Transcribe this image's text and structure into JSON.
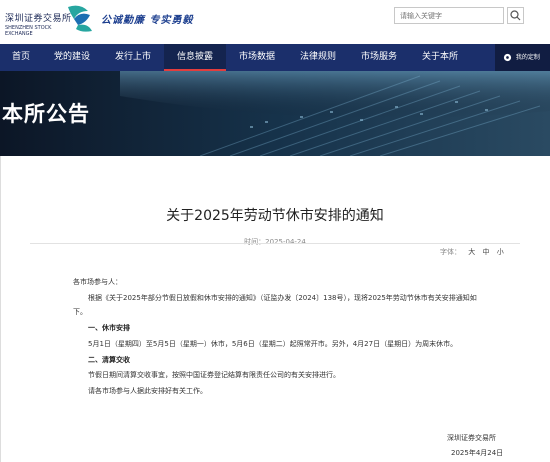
{
  "header": {
    "logo_cn": "深圳证券交易所",
    "logo_en": "SHENZHEN STOCK EXCHANGE",
    "slogan": "公诚勤廉 专实勇毅",
    "search_placeholder": "请输入关键字"
  },
  "nav": {
    "items": [
      {
        "label": "首页"
      },
      {
        "label": "党的建设"
      },
      {
        "label": "发行上市"
      },
      {
        "label": "信息披露"
      },
      {
        "label": "市场数据"
      },
      {
        "label": "法律规则"
      },
      {
        "label": "市场服务"
      },
      {
        "label": "关于本所"
      }
    ],
    "user_label": "我的定制"
  },
  "banner": {
    "title": "本所公告"
  },
  "article": {
    "title": "关于2025年劳动节休市安排的通知",
    "date": "时间：2025-04-24",
    "font_size_label": "字体：",
    "font_sizes": [
      "大",
      "中",
      "小"
    ],
    "salutation": "各市场参与人：",
    "intro_line1": "根据《关于2025年部分节假日放假和休市安排的通知》（证监办发〔2024〕138号），现将2025年劳动节休市有关安排通知如",
    "intro_line2": "下。",
    "section1_heading": "一、休市安排",
    "section1_body": "5月1日（星期四）至5月5日（星期一）休市，5月6日（星期二）起照常开市。另外，4月27日（星期日）为周末休市。",
    "section2_heading": "二、清算交收",
    "section2_body": "节假日期间清算交收事宜，按照中国证券登记结算有限责任公司的有关安排进行。",
    "closing": "请各市场参与人据此安排好有关工作。",
    "sign_org": "深圳证券交易所",
    "sign_date": "2025年4月24日"
  },
  "colors": {
    "nav_bg": "#1b2f6b",
    "nav_active": "#14244f",
    "active_underline": "#e33d3d",
    "brand_blue": "#1d3f8f"
  }
}
